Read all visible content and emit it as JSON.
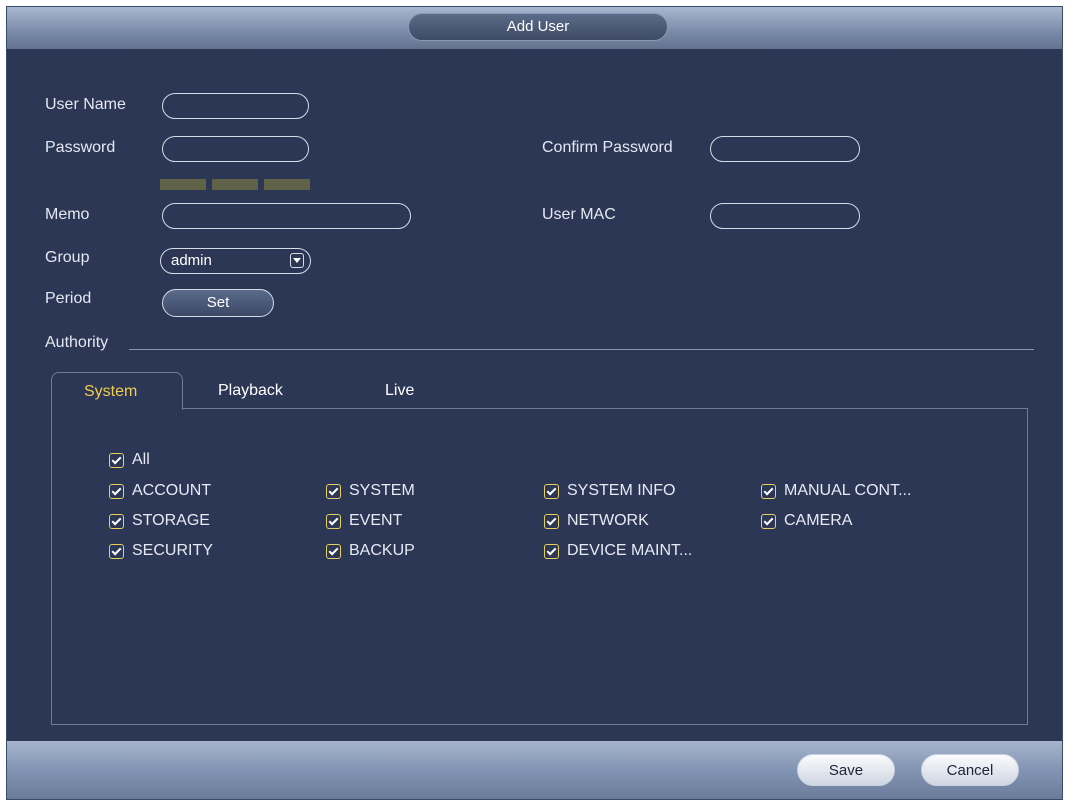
{
  "dialog": {
    "title": "Add User"
  },
  "form": {
    "user_name_label": "User Name",
    "password_label": "Password",
    "confirm_password_label": "Confirm Password",
    "memo_label": "Memo",
    "user_mac_label": "User MAC",
    "group_label": "Group",
    "group_value": "admin",
    "period_label": "Period",
    "set_button": "Set",
    "password_strength_color": "#5f6246"
  },
  "authority": {
    "label": "Authority",
    "tabs": [
      "System",
      "Playback",
      "Live"
    ],
    "active_tab": "System",
    "permissions": [
      {
        "label": "All",
        "checked": true
      },
      {
        "label": "ACCOUNT",
        "checked": true
      },
      {
        "label": "SYSTEM",
        "checked": true
      },
      {
        "label": "SYSTEM INFO",
        "checked": true
      },
      {
        "label": "MANUAL CONT...",
        "checked": true
      },
      {
        "label": "STORAGE",
        "checked": true
      },
      {
        "label": "EVENT",
        "checked": true
      },
      {
        "label": "NETWORK",
        "checked": true
      },
      {
        "label": "CAMERA",
        "checked": true
      },
      {
        "label": "SECURITY",
        "checked": true
      },
      {
        "label": "BACKUP",
        "checked": true
      },
      {
        "label": "DEVICE MAINT...",
        "checked": true
      }
    ]
  },
  "footer": {
    "save_button": "Save",
    "cancel_button": "Cancel"
  },
  "colors": {
    "background": "#2b3754",
    "active_tab": "#f0cd4e",
    "checkbox_border": "#e8cf62"
  }
}
